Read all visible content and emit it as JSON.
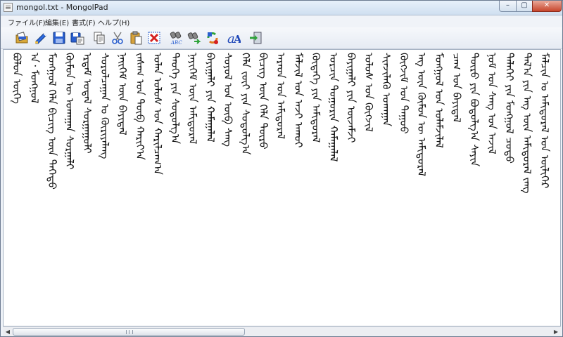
{
  "window": {
    "title": "mongol.txt - MongolPad"
  },
  "window_controls": {
    "minimize": "–",
    "maximize": "▢",
    "close": "✕"
  },
  "menu": [
    {
      "label": "ファイル(F)"
    },
    {
      "label": "編集(E)"
    },
    {
      "label": "書式(F)"
    },
    {
      "label": "ヘルプ(H)"
    }
  ],
  "toolbar_icons": [
    "open-folder-icon",
    "open-edit-icon",
    "save-icon",
    "save-as-icon",
    "copy-icon",
    "cut-scissors-icon",
    "paste-clipboard-icon",
    "delete-icon",
    "find-abc-icon",
    "find-replace-icon",
    "convert-icon",
    "font-icon",
    "exit-icon"
  ],
  "document": {
    "lines": [
      "ᠪᠣᠯᠣᠨ ᠦᠭᠡ",
      "ᠠ᠂ ᠮᠣᠩᠭᠣᠯ",
      "ᠮᠣᠩᠭᠣᠯ ᠬᠡᠯᠡ ᠪᠢᠴᠢᠭ ᠦᠨ ᠳᠡᠭᠡᠳᠦ",
      "ᠬᠦᠮᠦᠨ ᠦ ᠤᠬᠠᠭᠠᠨ ᠰᠤᠷᠭᠠᠯᠢ",
      "ᠡᠷᠳᠡᠮ ᠤᠳᠠᠯ ᠰᠤᠷᠭᠠᠭᠤᠯᠢ",
      "ᠰᠤᠷᠤᠯᠴᠠᠭᠠᠨ ᠤ ᠬᠦᠷᠢᠶᠡᠯᠡᠩ",
      "ᠨᠡᠢᠭᠡᠮ ᠦᠨ ᠪᠠᠶᠢᠳᠠᠯ",
      "ᠵᠠᠰᠠᠭ ᠤᠨ ᠲᠥᠪ ᠬᠠᠷᠢᠶ᠎ᠠ",
      "ᠣᠯᠠᠨ ᠤᠯᠤᠰ ᠤᠨ ᠬᠠᠷᠢᠯᠴᠠᠭ᠎ᠠ",
      "ᠲᠡᠦᠬᠡ ᠶᠢᠨ ᠰᠤᠳᠤᠯᠭ᠎ᠠ",
      "ᠨᠡᠶᠢᠭᠡᠮ ᠦᠨ ᠠᠮᠢᠳᠤᠷᠠᠯ",
      "ᠪᠠᠶᠢᠭᠠᠯᠢ ᠶᠢᠨ ᠬᠠᠮᠠᠭᠠᠯᠠᠯ",
      "ᠰᠤᠶᠤᠯ ᠤᠨ ᠥᠪ ᠰᠠᠩ",
      "ᠬᠡᠯᠡ ᠵᠦᠢ ᠶᠢᠨ ᠰᠤᠳᠤᠯᠭ᠎ᠠ",
      "ᠪᠢᠴᠢᠭ ᠦᠨ ᠬᠡᠯᠡ ᠲᠦᠷᠦ",
      "ᠠᠷᠠᠳ ᠤᠨ ᠠᠮᠢᠳᠤᠷᠠᠯ",
      "ᠮᠠᠯᠵᠢᠯ ᠤᠨ ᠠᠵᠢ ᠠᠬᠤᠢ",
      "ᠬᠦᠳᠡᠭᠡ ᠶᠢᠨ ᠠᠮᠢᠳᠤᠷᠠᠯ",
      "ᠣᠷᠴᠢᠨ ᠲᠣᠭᠣᠷᠢᠨ ᠬᠠᠮᠠᠭᠠᠯᠠᠯ",
      "ᠪᠠᠶᠢᠭᠠᠯᠢ ᠶᠢᠨ ᠦᠵᠡᠮᠵᠢ",
      "ᠤᠯᠤᠰ ᠤᠨ ᠬᠥᠭᠵᠢᠯ",
      "ᠰᠢᠨᠵᠢᠯᠡᠬᠦ ᠤᠬᠠᠭᠠᠨ",
      "ᠬᠥᠭᠵᠢᠮ ᠤᠨ ᠳᠠᠭᠤᠤ",
      "ᠡᠩ ᠦᠨ ᠬᠦᠮᠦᠨ ᠦ ᠠᠮᠢᠳᠤᠷᠠᠯ",
      "ᠮᠣᠩᠭᠣᠯ ᠤᠨ ᠤᠯᠠᠮᠵᠢᠯᠠᠯ",
      "ᠴᠠᠭ ᠤᠨ ᠪᠠᠶᠢᠳᠠᠯ",
      "ᠲᠥᠷᠥ ᠶᠢᠨ ᠪᠣᠳᠣᠯᠭ᠎ᠠ ᠰᠠᠶᠢᠨ",
      "ᠨᠣᠮ ᠤᠨ ᠰᠠᠩ ᠤᠨ ᠠᠵᠢᠯ",
      "ᠳᠡᠯᠡᠬᠡᠢ ᠶᠢᠨ ᠮᠣᠩᠭᠣᠯ ᠴᠤᠳᠤ",
      "ᠲᠠᠯ᠎ᠠ ᠶᠢᠨ ᠡᠩ ᠦᠨ ᠠᠮᠢᠳᠤᠷᠠᠯ ᠵᠠᠩ",
      "ᠮᠠᠯᠴᠢᠨ ᠤ ᠠᠮᠢᠳᠤᠷᠠᠯ ᠤᠨ ᠦᠯᠢᠭᠡᠷ"
    ]
  },
  "scrollbar": {
    "left_arrow": "◀",
    "right_arrow": "▶"
  }
}
